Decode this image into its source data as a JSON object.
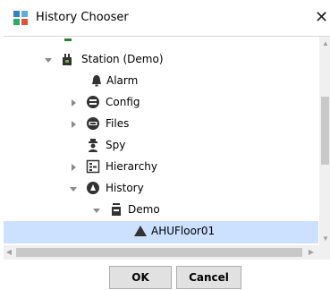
{
  "window": {
    "title": "History Chooser",
    "close_glyph": "✕"
  },
  "tree": {
    "items": [
      {
        "label": "Station (Demo)",
        "icon": "station-icon",
        "expanded": true
      },
      {
        "label": "Alarm",
        "icon": "alarm-bell-icon"
      },
      {
        "label": "Config",
        "icon": "config-icon",
        "expanded": false
      },
      {
        "label": "Files",
        "icon": "files-icon",
        "expanded": false
      },
      {
        "label": "Spy",
        "icon": "spy-icon"
      },
      {
        "label": "Hierarchy",
        "icon": "hierarchy-icon",
        "expanded": false
      },
      {
        "label": "History",
        "icon": "history-icon",
        "expanded": true
      },
      {
        "label": "Demo",
        "icon": "device-icon",
        "expanded": true
      },
      {
        "label": "AHUFloor01",
        "icon": "history-point-icon",
        "selected": true
      }
    ]
  },
  "buttons": {
    "ok": "OK",
    "cancel": "Cancel"
  },
  "colors": {
    "selection": "#cce0ff",
    "scrollbar_track": "#f0f0f0",
    "scrollbar_thumb": "#c8c8c8"
  }
}
